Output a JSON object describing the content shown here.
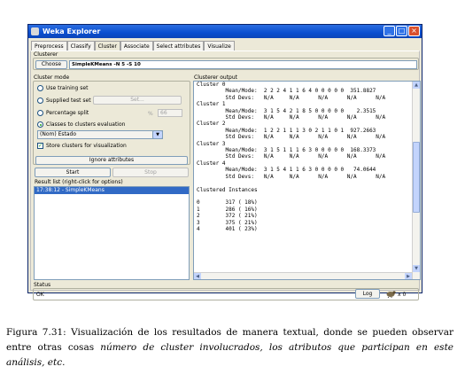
{
  "window": {
    "title": "Weka Explorer",
    "minimize": "_",
    "maximize": "□",
    "close": "×"
  },
  "tabs": [
    "Preprocess",
    "Classify",
    "Cluster",
    "Associate",
    "Select attributes",
    "Visualize"
  ],
  "clusterer": {
    "label": "Clusterer",
    "choose_label": "Choose",
    "value": "SimpleKMeans -N 5 -S 10"
  },
  "cluster_mode": {
    "label": "Cluster mode",
    "options": [
      "Use training set",
      "Supplied test set",
      "Percentage split",
      "Classes to clusters evaluation"
    ],
    "supplied_set_button": "Set...",
    "percent_symbol": "%",
    "percent_value": "66",
    "class_attribute": "(Nom) Estado",
    "store_clusters_label": "Store clusters for visualization",
    "ignore_attributes_button": "Ignore attributes"
  },
  "actions": {
    "start": "Start",
    "stop": "Stop"
  },
  "result_list": {
    "label": "Result list (right-click for options)",
    "items": [
      "17:38:12 - SimpleKMeans"
    ]
  },
  "output": {
    "label": "Clusterer output",
    "lines": [
      "Cluster 0",
      "         Mean/Mode:  2 2 2 4 1 1 6 4 0 0 0 0 0  351.8827",
      "         Std Devs:   N/A     N/A      N/A      N/A      N/A",
      "Cluster 1",
      "         Mean/Mode:  3 1 5 4 2 1 8 5 0 0 0 0 0    2.3515",
      "         Std Devs:   N/A     N/A      N/A      N/A      N/A",
      "Cluster 2",
      "         Mean/Mode:  1 2 2 1 1 1 3 0 2 1 1 0 1  927.2663",
      "         Std Devs:   N/A     N/A      N/A      N/A      N/A",
      "Cluster 3",
      "         Mean/Mode:  3 1 5 1 1 1 6 3 0 0 0 0 0  168.3373",
      "         Std Devs:   N/A     N/A      N/A      N/A      N/A",
      "Cluster 4",
      "         Mean/Mode:  3 1 5 4 1 1 6 3 0 0 0 0 0   74.0644",
      "         Std Devs:   N/A     N/A      N/A      N/A      N/A",
      "",
      "Clustered Instances",
      "",
      "0        317 ( 18%)",
      "1        286 ( 16%)",
      "2        372 ( 21%)",
      "3        375 ( 21%)",
      "4        401 ( 23%)"
    ]
  },
  "status": {
    "label": "Status",
    "text": "OK",
    "log_button": "Log",
    "count": "x 0"
  },
  "caption": {
    "prefix": "Figura 7.31: Visualización de los resultados de manera textual, donde se pueden observar entre otras cosas ",
    "emphasis": "número de cluster involucrados, los atributos que participan en este análisis, etc."
  }
}
